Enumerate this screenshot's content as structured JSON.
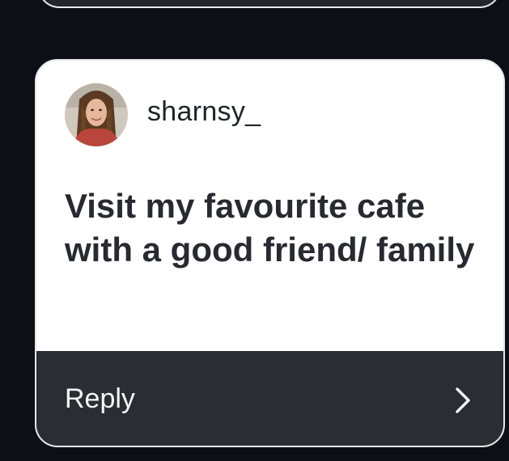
{
  "post": {
    "username": "sharnsy_",
    "prompt": "Visit my favourite cafe with a good friend/ family",
    "reply_label": "Reply"
  },
  "icons": {
    "avatar": "avatar-photo",
    "reply_arrow": "chevron-right-icon"
  },
  "colors": {
    "background": "#0c1016",
    "card": "#ffffff",
    "reply_bar": "#2a2d33",
    "text_dark": "#272a30",
    "text_light": "#f4f5f7"
  }
}
